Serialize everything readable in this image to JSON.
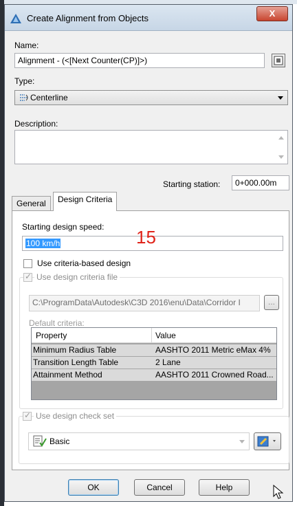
{
  "dialog": {
    "title": "Create Alignment from Objects",
    "close_label": "X"
  },
  "name": {
    "label": "Name:",
    "value": "Alignment - (<[Next Counter(CP)]>)"
  },
  "type": {
    "label": "Type:",
    "value": "Centerline"
  },
  "description": {
    "label": "Description:",
    "value": ""
  },
  "starting_station": {
    "label": "Starting station:",
    "value": "0+000.00m"
  },
  "tabs": [
    {
      "label": "General",
      "active": false
    },
    {
      "label": "Design Criteria",
      "active": true
    }
  ],
  "design": {
    "speed_label": "Starting design speed:",
    "speed_value": "100 km/h",
    "annotation_number": "15",
    "use_criteria_label": "Use criteria-based design",
    "use_criteria_checked": false,
    "use_file_label": "Use design criteria file",
    "use_file_checked": true,
    "file_path": "C:\\ProgramData\\Autodesk\\C3D 2016\\enu\\Data\\Corridor I",
    "browse_label": "...",
    "default_criteria_label": "Default criteria:",
    "grid_headers": [
      "Property",
      "Value"
    ],
    "grid_rows": [
      {
        "property": "Minimum Radius Table",
        "value": "AASHTO 2011 Metric eMax 4%"
      },
      {
        "property": "Transition Length Table",
        "value": "2 Lane"
      },
      {
        "property": "Attainment Method",
        "value": "AASHTO 2011 Crowned Road..."
      }
    ],
    "use_check_set_label": "Use design check set",
    "use_check_set_checked": true,
    "check_set_value": "Basic"
  },
  "buttons": {
    "ok": "OK",
    "cancel": "Cancel",
    "help": "Help"
  },
  "colors": {
    "accent_red": "#e0241a",
    "selection_blue": "#3399ff"
  }
}
